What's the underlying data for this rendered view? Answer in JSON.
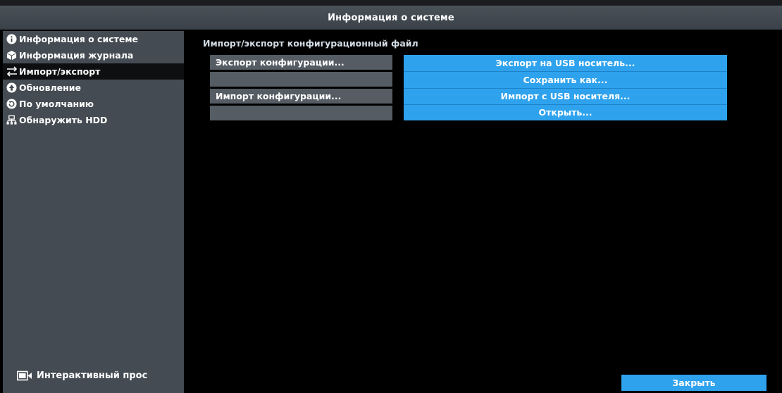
{
  "window": {
    "title": "Информация о системе"
  },
  "sidebar": {
    "items": [
      {
        "label": "Информация о системе",
        "icon": "info-icon"
      },
      {
        "label": "Информация журнала",
        "icon": "cube-icon"
      },
      {
        "label": "Импорт/экспорт",
        "icon": "import-export-icon",
        "active": true
      },
      {
        "label": "Обновление",
        "icon": "upgrade-icon"
      },
      {
        "label": "По умолчанию",
        "icon": "default-icon"
      },
      {
        "label": "Обнаружить HDD",
        "icon": "hdd-icon"
      }
    ],
    "bottom": {
      "label": "Интерактивный прос",
      "icon": "camera-icon"
    }
  },
  "main": {
    "section_title": "Импорт/экспорт конфигурационный файл",
    "rows": [
      {
        "label": "Экспорт конфигурации..."
      },
      {
        "label": ""
      },
      {
        "label": "Импорт конфигурации..."
      },
      {
        "label": ""
      }
    ],
    "buttons": [
      {
        "label": "Экспорт на USB носитель..."
      },
      {
        "label": "Сохранить как..."
      },
      {
        "label": "Импорт с USB носителя..."
      },
      {
        "label": "Открыть..."
      }
    ],
    "close_label": "Закрыть"
  },
  "colors": {
    "accent": "#2fa2ee",
    "sidebar_bg": "#444b52",
    "row_bg": "#555c63",
    "background": "#000000"
  }
}
